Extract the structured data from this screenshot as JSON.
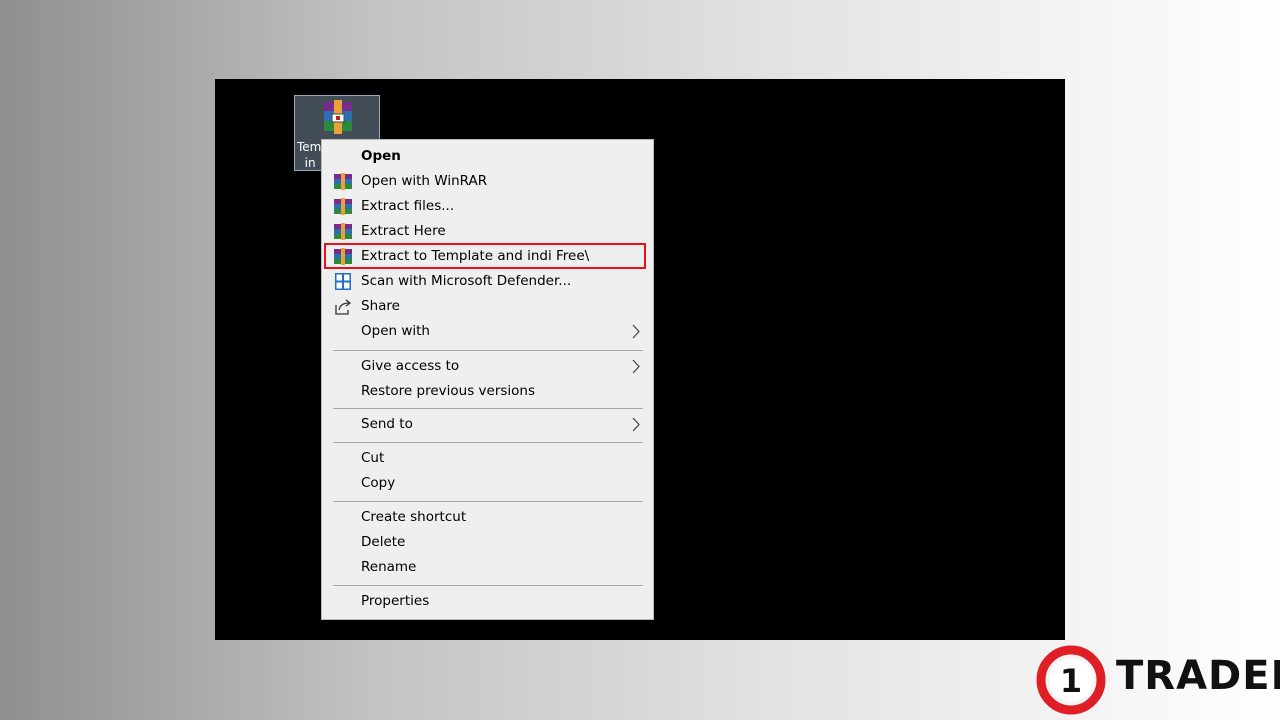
{
  "desktop": {
    "icon_label": "Tem\n  in",
    "icon_name": "winrar-archive-icon"
  },
  "menu": {
    "open": "Open",
    "open_with_winrar": "Open with WinRAR",
    "extract_files": "Extract files...",
    "extract_here": "Extract Here",
    "extract_to": "Extract to Template and indi Free\\",
    "scan_defender": "Scan with Microsoft Defender...",
    "share": "Share",
    "open_with": "Open with",
    "give_access": "Give access to",
    "restore_versions": "Restore previous versions",
    "send_to": "Send to",
    "cut": "Cut",
    "copy": "Copy",
    "create_shortcut": "Create shortcut",
    "delete": "Delete",
    "rename": "Rename",
    "properties": "Properties"
  },
  "colors": {
    "highlight_border": "#e8101a",
    "menu_bg": "#efefef",
    "logo_red": "#e01e26"
  },
  "logo": {
    "digit": "1",
    "word": "TRADER"
  }
}
